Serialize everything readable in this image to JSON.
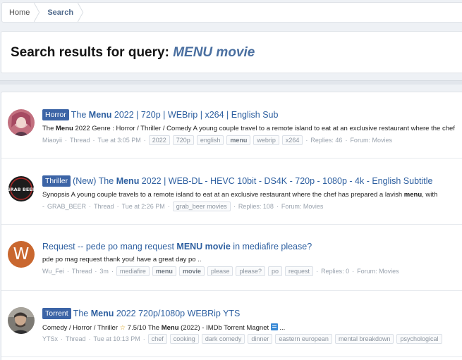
{
  "breadcrumb": {
    "home": "Home",
    "current": "Search"
  },
  "page": {
    "title_prefix": "Search results for query: ",
    "query": "MENU movie"
  },
  "results": [
    {
      "prefix": "Horror",
      "title_before": "The ",
      "title_bold": "Menu",
      "title_after": " 2022 | 720p | WEBrip | x264 | English Sub",
      "snippet_before": "The ",
      "snippet_bold": "Menu",
      "snippet_after": " 2022 Genre : Horror / Thriller / Comedy A young couple travel to a remote island to eat at an exclusive restaurant where the chef",
      "author": "Miaoyii",
      "type": "Thread",
      "time": "Tue at 3:05 PM",
      "tags": [
        {
          "label": "2022",
          "strong": false
        },
        {
          "label": "720p",
          "strong": false
        },
        {
          "label": "english",
          "strong": false
        },
        {
          "label": "menu",
          "strong": true
        },
        {
          "label": "webrip",
          "strong": false
        },
        {
          "label": "x264",
          "strong": false
        }
      ],
      "replies": "Replies: 46",
      "forum": "Forum: Movies",
      "avatar_type": "photo-pink"
    },
    {
      "prefix": "Thriller",
      "title_before": "(New) The ",
      "title_bold": "Menu",
      "title_after": " 2022 | WEB-DL - HEVC 10bit - DS4K - 720p - 1080p - 4k - English Subtitle",
      "snippet_before": "Synopsis A young couple travels to a remote island to eat at an exclusive restaurant where the chef has prepared a lavish ",
      "snippet_bold": "menu",
      "snippet_after": ", with",
      "author": "GRAB_BEER",
      "type": "Thread",
      "time": "Tue at 2:26 PM",
      "tags": [
        {
          "label": "grab_beer movies",
          "strong": false
        }
      ],
      "replies": "Replies: 108",
      "forum": "Forum: Movies",
      "avatar_type": "grab-beer",
      "avatar_text": "GRAB BEER"
    },
    {
      "prefix": "",
      "title_before": "Request -- pede po mang request ",
      "title_bold": "MENU movie",
      "title_after": " in mediafire please?",
      "snippet_before": "pde po mag request thank you! have a great day po ..",
      "snippet_bold": "",
      "snippet_after": "",
      "author": "Wu_Fei",
      "type": "Thread",
      "time": "3m",
      "tags": [
        {
          "label": "mediafire",
          "strong": false
        },
        {
          "label": "menu",
          "strong": true
        },
        {
          "label": "movie",
          "strong": true
        },
        {
          "label": "please",
          "strong": false
        },
        {
          "label": "please?",
          "strong": false
        },
        {
          "label": "po",
          "strong": false
        },
        {
          "label": "request",
          "strong": false
        }
      ],
      "replies": "Replies: 0",
      "forum": "Forum: Movies",
      "avatar_type": "letter",
      "avatar_text": "W"
    },
    {
      "prefix": "Torrent",
      "title_before": "The ",
      "title_bold": "Menu",
      "title_after": " 2022 720p/1080p WEBRip YTS",
      "snippet_before": "Comedy / Horror / Thriller ",
      "snippet_star": "☆",
      "snippet_mid": " 7.5/10 The ",
      "snippet_bold": "Menu",
      "snippet_after": " (2022) - IMDb Torrent Magnet ",
      "snippet_end": " ...",
      "author": "YTSx",
      "type": "Thread",
      "time": "Tue at 10:13 PM",
      "tags": [
        {
          "label": "chef",
          "strong": false
        },
        {
          "label": "cooking",
          "strong": false
        },
        {
          "label": "dark comedy",
          "strong": false
        },
        {
          "label": "dinner",
          "strong": false
        },
        {
          "label": "eastern european",
          "strong": false
        },
        {
          "label": "mental breakdown",
          "strong": false
        },
        {
          "label": "psychological",
          "strong": false
        }
      ],
      "replies": "",
      "forum": "",
      "avatar_type": "photo-man"
    }
  ],
  "colors": {
    "prefix_bg": "#3c64a6",
    "link": "#2d5fa0",
    "letter_avatar": "#c9672f"
  }
}
